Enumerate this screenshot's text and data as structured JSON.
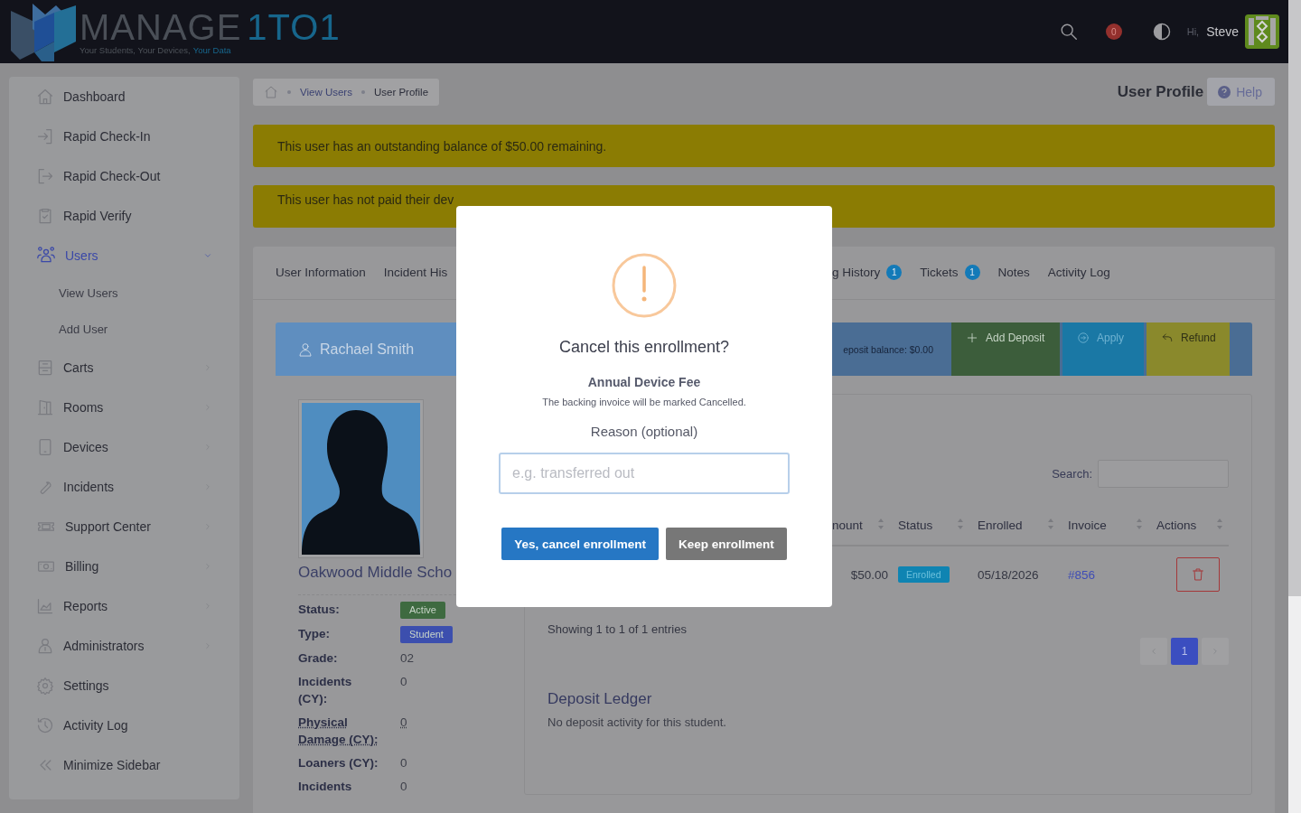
{
  "header": {
    "logo": {
      "word": "MANAGE",
      "number": "1TO1",
      "tagline": "Your Students, Your Devices,",
      "tagline_highlight": "Your Data"
    },
    "notifications": {
      "count": "0"
    },
    "greeting": "Hi,",
    "user_name": "Steve"
  },
  "sidebar": {
    "items": [
      {
        "kind": "link",
        "label": "Dashboard",
        "selected": false
      },
      {
        "kind": "link",
        "label": "Rapid Check-In",
        "selected": false
      },
      {
        "kind": "link",
        "label": "Rapid Check-Out",
        "selected": false
      },
      {
        "kind": "link",
        "label": "Rapid Verify",
        "selected": false
      },
      {
        "kind": "group",
        "label": "Users",
        "selected": true,
        "expanded": true,
        "children": [
          {
            "label": "View Users",
            "selected": false
          },
          {
            "label": "Add User",
            "selected": false
          }
        ]
      },
      {
        "kind": "group",
        "label": "Carts",
        "selected": false,
        "expanded": false
      },
      {
        "kind": "group",
        "label": "Rooms",
        "selected": false,
        "expanded": false
      },
      {
        "kind": "group",
        "label": "Devices",
        "selected": false,
        "expanded": false
      },
      {
        "kind": "group",
        "label": "Incidents",
        "selected": false,
        "expanded": false
      },
      {
        "kind": "group",
        "label": "Support Center",
        "selected": false,
        "expanded": false
      },
      {
        "kind": "group",
        "label": "Billing",
        "selected": false,
        "expanded": false
      },
      {
        "kind": "group",
        "label": "Reports",
        "selected": false,
        "expanded": false
      },
      {
        "kind": "group",
        "label": "Administrators",
        "selected": false,
        "expanded": false
      },
      {
        "kind": "link",
        "label": "Settings",
        "selected": false
      },
      {
        "kind": "link",
        "label": "Activity Log",
        "selected": false
      },
      {
        "kind": "link",
        "label": "Minimize Sidebar",
        "selected": false
      }
    ]
  },
  "breadcrumb": [
    "View Users",
    "User Profile"
  ],
  "page_title": "User Profile",
  "help_button": "Help",
  "alerts": [
    "This user has an outstanding balance of $50.00 remaining.",
    "This user has not paid their dev"
  ],
  "tabs": [
    {
      "label": "User Information",
      "selected": false
    },
    {
      "label": "Incident His",
      "selected": false
    },
    {
      "label": "g History",
      "count": "1",
      "selected": false
    },
    {
      "label": "Tickets",
      "count": "1",
      "selected": false
    },
    {
      "label": "Notes",
      "selected": false
    },
    {
      "label": "Activity Log",
      "selected": false
    }
  ],
  "profile": {
    "name": "Rachael Smith",
    "school": "Oakwood Middle Scho",
    "fields": [
      {
        "kind": "badge",
        "label": "Status:",
        "value": "Active",
        "color": "#3e6a40"
      },
      {
        "kind": "badge",
        "label": "Type:",
        "value": "Student",
        "color": "#3c4fae"
      },
      {
        "kind": "text",
        "label": "Grade:",
        "value": "02"
      },
      {
        "kind": "text",
        "label": "Incidents (CY):",
        "value": "0"
      },
      {
        "kind": "abbr",
        "label": "Physical Damage (CY):",
        "value": "0"
      },
      {
        "kind": "text",
        "label": "Loaners (CY):",
        "value": "0"
      },
      {
        "kind": "text",
        "label": "Incidents",
        "value": "0"
      }
    ]
  },
  "enrollments": {
    "deposit_balance": "eposit balance: $0.00",
    "actions": [
      {
        "kind": "add",
        "label": "Add Deposit"
      },
      {
        "kind": "apply",
        "label": "Apply"
      },
      {
        "kind": "refund",
        "label": "Refund"
      }
    ],
    "search_label": "Search:",
    "columns": [
      "nount",
      "Status",
      "Enrolled",
      "Invoice",
      "Actions"
    ],
    "rows": [
      {
        "amount": "$50.00",
        "status": "Enrolled",
        "enrolled": "05/18/2026",
        "invoice": "#856"
      }
    ],
    "info": "Showing 1 to 1 of 1 entries",
    "pages": [
      {
        "label": "1",
        "selected": true
      }
    ]
  },
  "deposit_ledger": {
    "title": "Deposit Ledger",
    "text": "No deposit activity for this student."
  },
  "dialog": {
    "title": "Cancel this enrollment?",
    "item": "Annual Device Fee",
    "note": "The backing invoice will be marked Cancelled.",
    "reason_label": "Reason (optional)",
    "reason_placeholder": "e.g. transferred out",
    "buttons": [
      {
        "kind": "primary",
        "label": "Yes, cancel enrollment"
      },
      {
        "kind": "secondary",
        "label": "Keep enrollment"
      }
    ]
  }
}
